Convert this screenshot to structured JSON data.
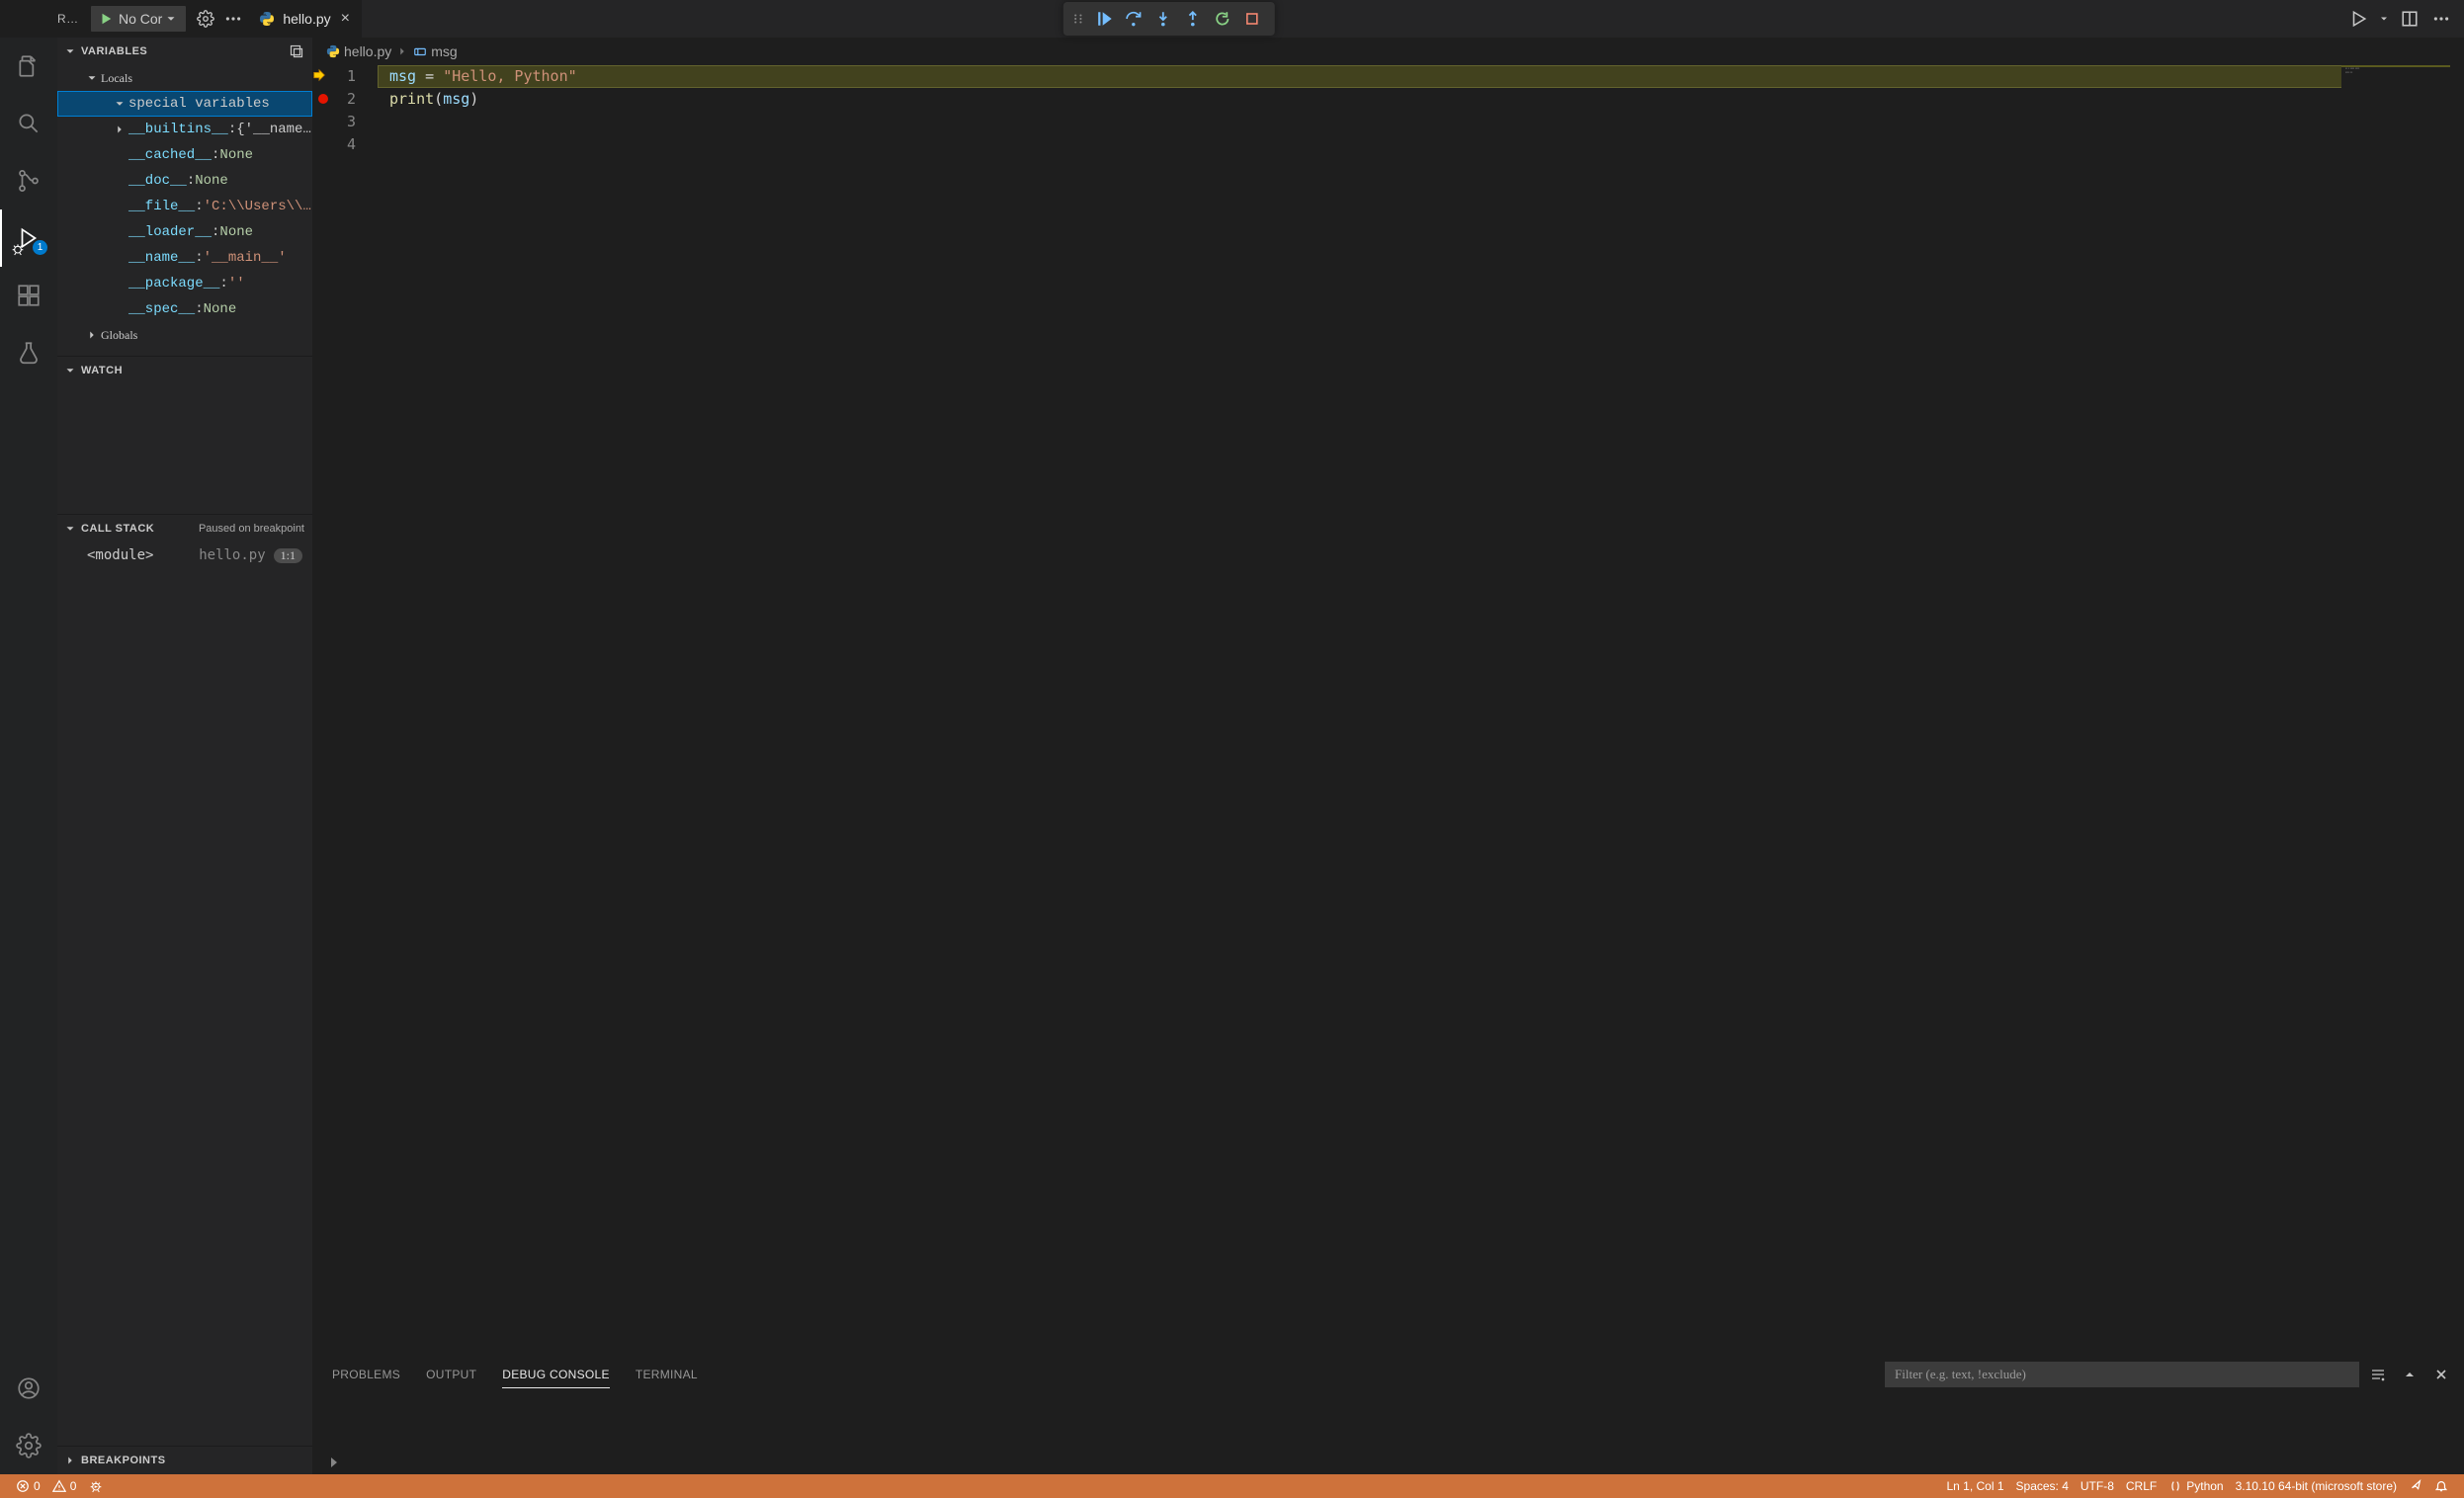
{
  "sidebar_header": {
    "label": "RUN AND DEBUG",
    "config": "No Configurations"
  },
  "tab": {
    "name": "hello.py"
  },
  "breadcrumb": {
    "file": "hello.py",
    "symbol": "msg"
  },
  "activity_badge": "1",
  "sections": {
    "variables_title": "VARIABLES",
    "watch_title": "WATCH",
    "callstack_title": "CALL STACK",
    "callstack_status": "Paused on breakpoint",
    "breakpoints_title": "BREAKPOINTS"
  },
  "variables": {
    "scopes": [
      "Locals",
      "Globals"
    ],
    "special_label": "special variables",
    "locals": [
      {
        "key": "__builtins__",
        "value": "{'__name…",
        "expandable": true,
        "vclass": "ellips"
      },
      {
        "key": "__cached__",
        "value": "None",
        "vclass": "val"
      },
      {
        "key": "__doc__",
        "value": "None",
        "vclass": "val"
      },
      {
        "key": "__file__",
        "value": "'C:\\\\Users\\\\…",
        "vclass": "val-str"
      },
      {
        "key": "__loader__",
        "value": "None",
        "vclass": "val"
      },
      {
        "key": "__name__",
        "value": "'__main__'",
        "vclass": "val-str"
      },
      {
        "key": "__package__",
        "value": "''",
        "vclass": "val-str"
      },
      {
        "key": "__spec__",
        "value": "None",
        "vclass": "val"
      }
    ]
  },
  "callstack": {
    "frame": "<module>",
    "file": "hello.py",
    "loc": "1:1"
  },
  "code": {
    "lines": [
      {
        "num": "1",
        "current": true,
        "tokens": [
          [
            "msg",
            "tok-var"
          ],
          [
            " = ",
            "tok-op"
          ],
          [
            "\"Hello, Python\"",
            "tok-str"
          ]
        ]
      },
      {
        "num": "2",
        "bp": true,
        "tokens": [
          [
            "print",
            "tok-fn"
          ],
          [
            "(",
            "tok-punc"
          ],
          [
            "msg",
            "tok-var"
          ],
          [
            ")",
            "tok-punc"
          ]
        ]
      },
      {
        "num": "3",
        "tokens": []
      },
      {
        "num": "4",
        "tokens": []
      }
    ]
  },
  "panel": {
    "tabs": [
      "PROBLEMS",
      "OUTPUT",
      "DEBUG CONSOLE",
      "TERMINAL"
    ],
    "active": 2,
    "filter_placeholder": "Filter (e.g. text, !exclude)"
  },
  "status": {
    "errors": "0",
    "warnings": "0",
    "ln_col": "Ln 1, Col 1",
    "spaces": "Spaces: 4",
    "encoding": "UTF-8",
    "eol": "CRLF",
    "lang": "Python",
    "interpreter": "3.10.10 64-bit (microsoft store)"
  }
}
